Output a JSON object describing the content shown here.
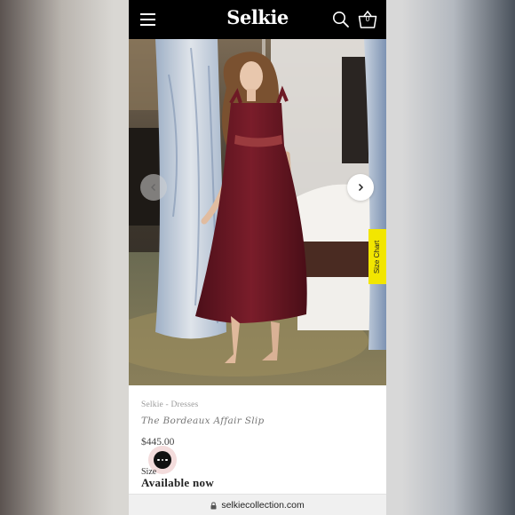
{
  "header": {
    "logo": "Selkie",
    "cart_count": "0",
    "icons": [
      "hamburger-menu-icon",
      "search-icon",
      "shopping-basket-icon"
    ]
  },
  "hero": {
    "size_chart_label": "Size Chart",
    "prev_icon": "chevron-left-icon",
    "next_icon": "chevron-right-icon",
    "dress_color": "#6e1a25"
  },
  "product": {
    "breadcrumb": "Selkie - Dresses",
    "title": "The Bordeaux Affair Slip",
    "price": "$445.00",
    "size_label": "Size",
    "availability": "Available now"
  },
  "chat": {
    "icon": "chat-bubble-icon"
  },
  "browser": {
    "url": "selkiecollection.com"
  }
}
